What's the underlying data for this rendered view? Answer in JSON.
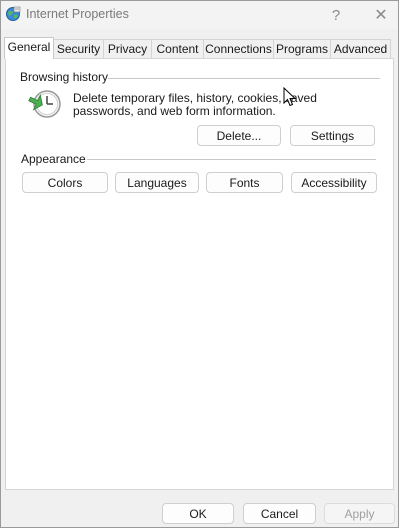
{
  "window": {
    "title": "Internet Properties",
    "help_glyph": "?",
    "close_glyph": "✕"
  },
  "tabs": [
    {
      "label": "General",
      "active": true
    },
    {
      "label": "Security"
    },
    {
      "label": "Privacy"
    },
    {
      "label": "Content"
    },
    {
      "label": "Connections"
    },
    {
      "label": "Programs"
    },
    {
      "label": "Advanced"
    }
  ],
  "browsing_history": {
    "heading": "Browsing history",
    "description": "Delete temporary files, history, cookies, saved passwords, and web form information.",
    "delete_label": "Delete...",
    "settings_label": "Settings"
  },
  "appearance": {
    "heading": "Appearance",
    "colors_label": "Colors",
    "languages_label": "Languages",
    "fonts_label": "Fonts",
    "accessibility_label": "Accessibility"
  },
  "footer": {
    "ok_label": "OK",
    "cancel_label": "Cancel",
    "apply_label": "Apply",
    "apply_enabled": false
  },
  "icons": {
    "app": "internet-globe-icon",
    "history": "clock-refresh-icon",
    "cursor": "mouse-pointer-icon"
  }
}
